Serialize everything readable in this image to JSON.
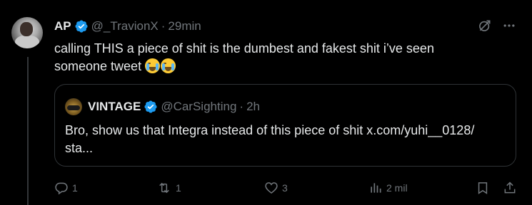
{
  "tweet": {
    "display_name": "AP",
    "handle": "@_TravionX",
    "separator": "·",
    "time": "29min",
    "text_line1": "calling THIS a piece of shit is the dumbest and fakest shit i’ve seen",
    "text_line2": "someone tweet",
    "emoji": "loudly-crying-face",
    "emoji_count": 2
  },
  "quote": {
    "display_name": "VINTAGE",
    "handle": "@CarSighting",
    "separator": "·",
    "time": "2h",
    "text_line1": "Bro, show us that Integra instead of this piece of shit x.com/yuhi__0128/",
    "text_line2": "sta..."
  },
  "actions": {
    "replies": "1",
    "reposts": "1",
    "likes": "3",
    "views": "2 mil"
  },
  "colors": {
    "background": "#000000",
    "text": "#e7e9ea",
    "muted": "#71767b",
    "verified": "#1d9bf0",
    "border": "#2f3336"
  },
  "icons": [
    "grok-icon",
    "more-icon",
    "verified-badge-icon",
    "reply-icon",
    "repost-icon",
    "like-icon",
    "views-icon",
    "bookmark-icon",
    "share-icon"
  ]
}
